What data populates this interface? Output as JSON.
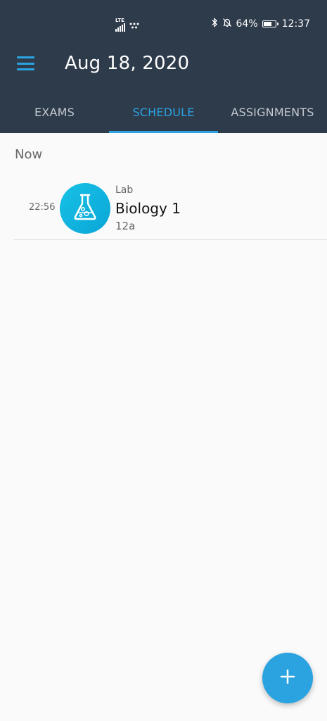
{
  "status_bar": {
    "network": "LTE",
    "battery_percent": "64%",
    "time": "12:37",
    "battery_level": 0.64,
    "icons": [
      "signal-icon",
      "data-dots-icon",
      "bluetooth-icon",
      "bell-off-icon",
      "battery-icon"
    ]
  },
  "header": {
    "menu_icon": "menu-icon",
    "title": "Aug 18, 2020",
    "tabs": [
      {
        "label": "EXAMS",
        "active": false
      },
      {
        "label": "SCHEDULE",
        "active": true
      },
      {
        "label": "ASSIGNMENTS",
        "active": false
      }
    ]
  },
  "schedule": {
    "section_label": "Now",
    "items": [
      {
        "time": "22:56",
        "type": "Lab",
        "title": "Biology 1",
        "room": "12a",
        "icon": "flask-icon"
      }
    ]
  },
  "fab": {
    "icon": "plus-icon"
  },
  "colors": {
    "header_bg": "#2e3b4b",
    "accent": "#2aa3e0",
    "avatar": "#17c1e6",
    "background": "#fafafa"
  }
}
